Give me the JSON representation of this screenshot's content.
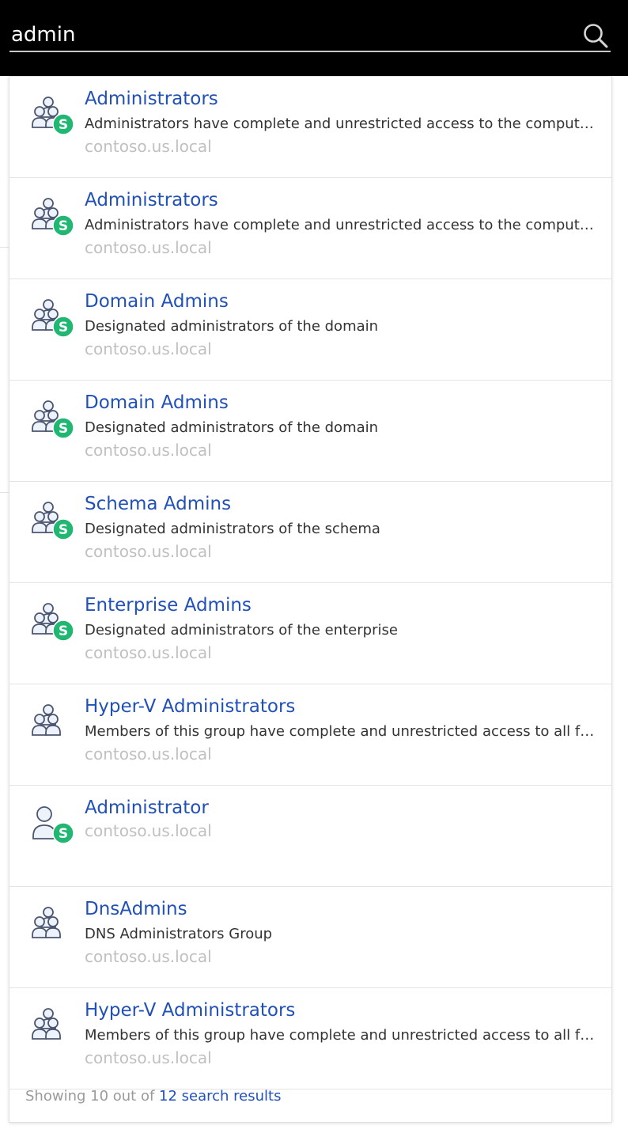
{
  "search": {
    "value": "admin",
    "placeholder": ""
  },
  "results": [
    {
      "title": "Administrators",
      "description": "Administrators have complete and unrestricted access to the computer/domain",
      "domain": "contoso.us.local",
      "icon": "group-security-icon",
      "badge": "S"
    },
    {
      "title": "Administrators",
      "description": "Administrators have complete and unrestricted access to the computer/domain",
      "domain": "contoso.us.local",
      "icon": "group-security-icon",
      "badge": "S"
    },
    {
      "title": "Domain Admins",
      "description": "Designated administrators of the domain",
      "domain": "contoso.us.local",
      "icon": "group-security-icon",
      "badge": "S"
    },
    {
      "title": "Domain Admins",
      "description": "Designated administrators of the domain",
      "domain": "contoso.us.local",
      "icon": "group-security-icon",
      "badge": "S"
    },
    {
      "title": "Schema Admins",
      "description": "Designated administrators of the schema",
      "domain": "contoso.us.local",
      "icon": "group-security-icon",
      "badge": "S"
    },
    {
      "title": "Enterprise Admins",
      "description": "Designated administrators of the enterprise",
      "domain": "contoso.us.local",
      "icon": "group-security-icon",
      "badge": "S"
    },
    {
      "title": "Hyper-V Administrators",
      "description": "Members of this group have complete and unrestricted access to all features of Hyper-V",
      "domain": "contoso.us.local",
      "icon": "group-icon",
      "badge": ""
    },
    {
      "title": "Administrator",
      "description": "",
      "domain": "contoso.us.local",
      "icon": "user-security-icon",
      "badge": "S"
    },
    {
      "title": "DnsAdmins",
      "description": "DNS Administrators Group",
      "domain": "contoso.us.local",
      "icon": "group-icon",
      "badge": ""
    },
    {
      "title": "Hyper-V Administrators",
      "description": "Members of this group have complete and unrestricted access to all features of Hyper-V",
      "domain": "contoso.us.local",
      "icon": "group-icon",
      "badge": ""
    }
  ],
  "footer": {
    "prefix": "Showing 10 out of ",
    "link": "12 search results"
  },
  "colors": {
    "topbar": "#000000",
    "link": "#2050b8",
    "badge": "#1fb771",
    "muted": "#c0c0c0"
  }
}
